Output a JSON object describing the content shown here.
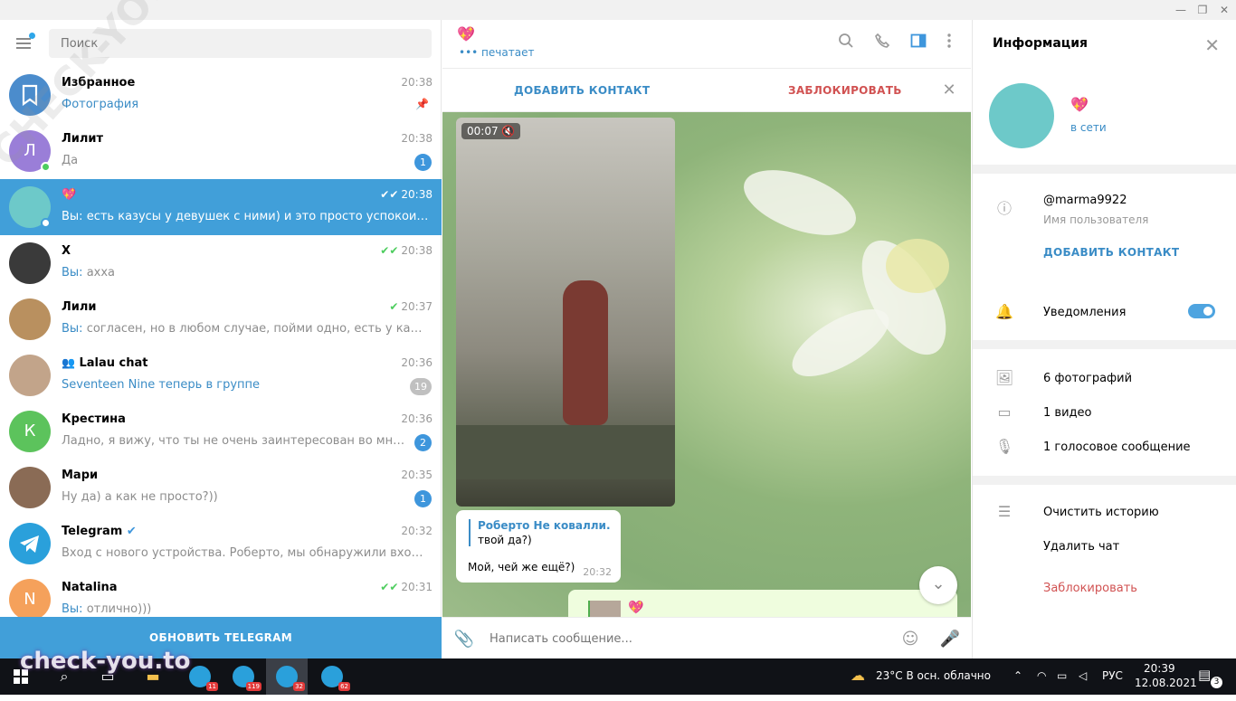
{
  "window": {
    "minimize": "—",
    "maximize": "❐",
    "close": "✕"
  },
  "search": {
    "placeholder": "Поиск"
  },
  "chats": [
    {
      "name": "Избранное",
      "time": "20:38",
      "message": "Фотография",
      "message_blue": true,
      "pinned": true,
      "avatar_color": "#4b8ccc"
    },
    {
      "name": "Лилит",
      "time": "20:38",
      "message": "Да",
      "badge": "1",
      "avatar_letter": "Л",
      "avatar_color": "#9a7ed8",
      "online": true
    },
    {
      "name": "💖",
      "time": "20:38",
      "prefix": "Вы:",
      "message": "есть казусы у девушек с ними) и это просто успокоит меня) ...",
      "read": true,
      "avatar_color": "#6dc9c9",
      "online": true,
      "active": true
    },
    {
      "name": "Х",
      "time": "20:38",
      "prefix": "Вы:",
      "message": "ахха",
      "read": true,
      "avatar_color": "#3a3a3a"
    },
    {
      "name": "Лили",
      "time": "20:37",
      "prefix": "Вы:",
      "message": "согласен, но в любом случае, пойми одно, есть у каждого св...",
      "read": true,
      "avatar_color": "#b9905f"
    },
    {
      "name": "Lalau chat",
      "time": "20:36",
      "message": "Seventeen Nine теперь в группе",
      "message_blue": true,
      "badge": "19",
      "badge_muted": true,
      "group": true,
      "avatar_color": "#c2a48a"
    },
    {
      "name": "Крестина",
      "time": "20:36",
      "message": "Ладно, я вижу, что ты не очень заинтересован во мне, не бу...",
      "badge": "2",
      "avatar_letter": "К",
      "avatar_color": "#5cc35c"
    },
    {
      "name": "Мари",
      "time": "20:35",
      "message": "Ну да) а как не просто?))",
      "badge": "1",
      "avatar_color": "#8a6b55"
    },
    {
      "name": "Telegram",
      "time": "20:32",
      "message": "Вход с нового устройства. Роберто, мы обнаружили вход в Ваш ...",
      "verified": true,
      "avatar_color": "#2aa0db"
    },
    {
      "name": "Natalina",
      "time": "20:31",
      "prefix": "Вы:",
      "message": "отлично)))",
      "read": true,
      "avatar_letter": "N",
      "avatar_color": "#f5a15b"
    }
  ],
  "update_button": "ОБНОВИТЬ TELEGRAM",
  "chat_header": {
    "name": "💖",
    "status": "••• печатает"
  },
  "action_bar": {
    "add_contact": "ДОБАВИТЬ КОНТАКТ",
    "block": "ЗАБЛОКИРОВАТЬ"
  },
  "video": {
    "duration": "00:07"
  },
  "message": {
    "reply_name": "Роберто Не ковалли.",
    "reply_text": "твой да?)",
    "text": "Мой, чей же ещё?)",
    "time": "20:32"
  },
  "out_message": {
    "name": "💖"
  },
  "composer": {
    "placeholder": "Написать сообщение..."
  },
  "info": {
    "title": "Информация",
    "name": "💖",
    "status": "в сети",
    "username": "@marma9922",
    "username_label": "Имя пользователя",
    "add_contact": "ДОБАВИТЬ КОНТАКТ",
    "notifications": "Уведомления",
    "notifications_on": true,
    "photos": "6 фотографий",
    "videos": "1 видео",
    "voice": "1 голосовое сообщение",
    "clear_history": "Очистить историю",
    "delete_chat": "Удалить чат",
    "block": "Заблокировать"
  },
  "taskbar": {
    "badges": [
      "11",
      "119",
      "32",
      "62"
    ],
    "weather": "23°C  В осн. облачно",
    "lang": "РУС",
    "time": "20:39",
    "date": "12.08.2021",
    "notif_count": "3"
  },
  "watermarks": {
    "bottom": "check-you.to",
    "diagonal": "CHECK-YOU.ME"
  },
  "colors": {
    "accent": "#419fd9",
    "danger": "#d15252",
    "online": "#4dcd5e"
  }
}
